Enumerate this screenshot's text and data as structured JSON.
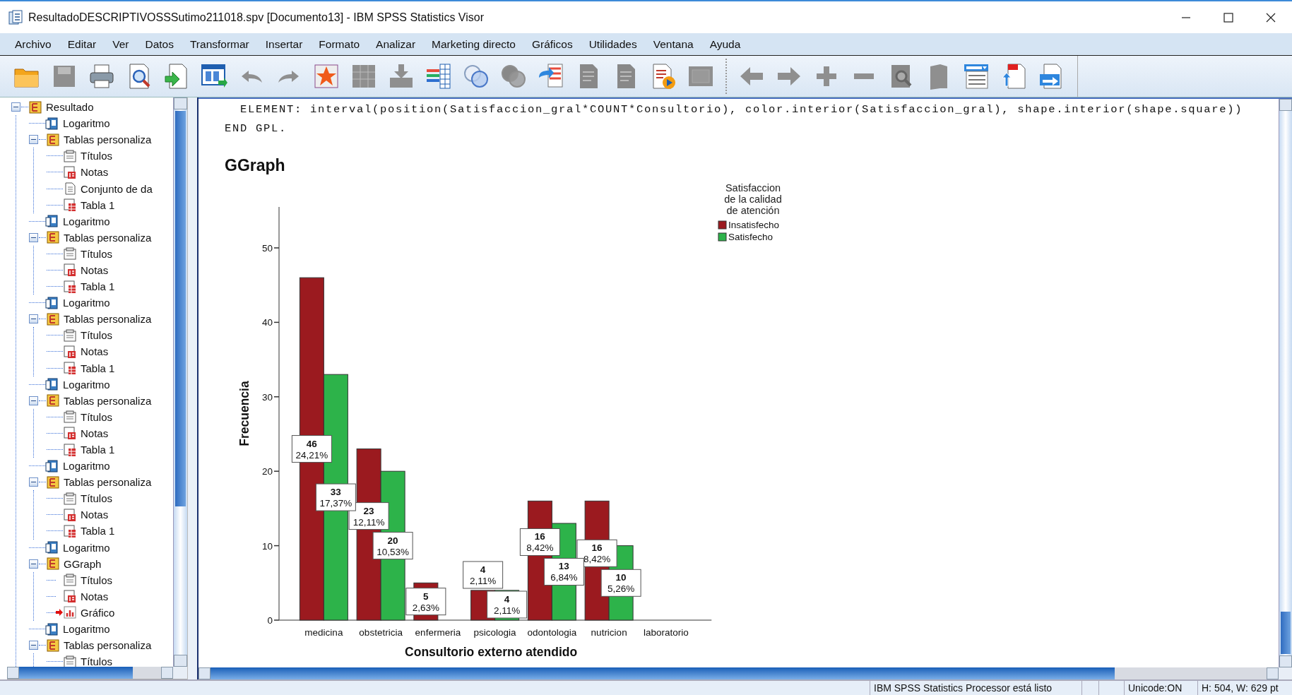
{
  "window": {
    "title": "ResultadoDESCRIPTIVOSSSutimo211018.spv [Documento13] - IBM SPSS Statistics Visor"
  },
  "menu": [
    "Archivo",
    "Editar",
    "Ver",
    "Datos",
    "Transformar",
    "Insertar",
    "Formato",
    "Analizar",
    "Marketing directo",
    "Gráficos",
    "Utilidades",
    "Ventana",
    "Ayuda"
  ],
  "toolbar": [
    {
      "kind": "folder",
      "disabled": false
    },
    {
      "kind": "save",
      "disabled": true
    },
    {
      "kind": "printer",
      "disabled": false
    },
    {
      "kind": "preview",
      "disabled": false
    },
    {
      "kind": "export",
      "disabled": false
    },
    {
      "kind": "datawindow",
      "disabled": false
    },
    {
      "kind": "undo",
      "disabled": true
    },
    {
      "kind": "redo",
      "disabled": true
    },
    {
      "kind": "startable",
      "disabled": false
    },
    {
      "kind": "grid",
      "disabled": true
    },
    {
      "kind": "download",
      "disabled": true
    },
    {
      "kind": "varlist",
      "disabled": false
    },
    {
      "kind": "circles",
      "disabled": false
    },
    {
      "kind": "circles",
      "disabled": true
    },
    {
      "kind": "arrowlist",
      "disabled": false
    },
    {
      "kind": "document",
      "disabled": true
    },
    {
      "kind": "document",
      "disabled": true
    },
    {
      "kind": "docplay",
      "disabled": false
    },
    {
      "kind": "frame",
      "disabled": true
    },
    {
      "kind": "separator"
    },
    {
      "kind": "left",
      "disabled": true
    },
    {
      "kind": "right",
      "disabled": true
    },
    {
      "kind": "plus",
      "disabled": true
    },
    {
      "kind": "minus",
      "disabled": true
    },
    {
      "kind": "docsearch",
      "disabled": true
    },
    {
      "kind": "book",
      "disabled": true
    },
    {
      "kind": "dropdown",
      "disabled": false
    },
    {
      "kind": "docup",
      "disabled": false
    },
    {
      "kind": "docarrow",
      "disabled": false
    }
  ],
  "tree": {
    "label": "Resultado",
    "kind": "root",
    "expanded": true,
    "children": [
      {
        "label": "Logaritmo",
        "kind": "log"
      },
      {
        "label": "Tablas personaliza",
        "kind": "group",
        "expanded": true,
        "children": [
          {
            "label": "Títulos",
            "kind": "titles"
          },
          {
            "label": "Notas",
            "kind": "notes"
          },
          {
            "label": "Conjunto de da",
            "kind": "dataset"
          },
          {
            "label": "Tabla 1",
            "kind": "table"
          }
        ]
      },
      {
        "label": "Logaritmo",
        "kind": "log"
      },
      {
        "label": "Tablas personaliza",
        "kind": "group",
        "expanded": true,
        "children": [
          {
            "label": "Títulos",
            "kind": "titles"
          },
          {
            "label": "Notas",
            "kind": "notes"
          },
          {
            "label": "Tabla 1",
            "kind": "table"
          }
        ]
      },
      {
        "label": "Logaritmo",
        "kind": "log"
      },
      {
        "label": "Tablas personaliza",
        "kind": "group",
        "expanded": true,
        "children": [
          {
            "label": "Títulos",
            "kind": "titles"
          },
          {
            "label": "Notas",
            "kind": "notes"
          },
          {
            "label": "Tabla 1",
            "kind": "table"
          }
        ]
      },
      {
        "label": "Logaritmo",
        "kind": "log"
      },
      {
        "label": "Tablas personaliza",
        "kind": "group",
        "expanded": true,
        "children": [
          {
            "label": "Títulos",
            "kind": "titles"
          },
          {
            "label": "Notas",
            "kind": "notes"
          },
          {
            "label": "Tabla 1",
            "kind": "table"
          }
        ]
      },
      {
        "label": "Logaritmo",
        "kind": "log"
      },
      {
        "label": "Tablas personaliza",
        "kind": "group",
        "expanded": true,
        "children": [
          {
            "label": "Títulos",
            "kind": "titles"
          },
          {
            "label": "Notas",
            "kind": "notes"
          },
          {
            "label": "Tabla 1",
            "kind": "table"
          }
        ]
      },
      {
        "label": "Logaritmo",
        "kind": "log"
      },
      {
        "label": "GGraph",
        "kind": "group",
        "expanded": true,
        "children": [
          {
            "label": "Títulos",
            "kind": "titles",
            "current": false
          },
          {
            "label": "Notas",
            "kind": "notes",
            "current": false
          },
          {
            "label": "Gráfico",
            "kind": "chart",
            "current": true
          }
        ]
      },
      {
        "label": "Logaritmo",
        "kind": "log"
      },
      {
        "label": "Tablas personaliza",
        "kind": "group",
        "expanded": true,
        "children": [
          {
            "label": "Títulos",
            "kind": "titles"
          }
        ]
      }
    ]
  },
  "output": {
    "syntax": [
      "  ELEMENT: interval(position(Satisfaccion_gral*COUNT*Consultorio), color.interior(Satisfaccion_gral), shape.interior(shape.square))",
      "END GPL."
    ],
    "heading": "GGraph",
    "chart_data": {
      "type": "bar",
      "xlabel": "Consultorio externo atendido",
      "ylabel": "Frecuencia",
      "categories": [
        "medicina",
        "obstetricia",
        "enfermeria",
        "psicologia",
        "odontologia",
        "nutricion",
        "laboratorio"
      ],
      "series": [
        {
          "name": "Insatisfecho",
          "color": "#9b1a1f",
          "values": [
            46,
            23,
            5,
            4,
            16,
            16,
            null
          ]
        },
        {
          "name": "Satisfecho",
          "color": "#2db34a",
          "values": [
            33,
            20,
            null,
            4,
            13,
            10,
            null
          ]
        }
      ],
      "ylim": [
        0,
        55.5
      ],
      "yticks": [
        0,
        10,
        20,
        30,
        40,
        50
      ],
      "data_labels": true,
      "value_labels": [
        [
          "24,21%",
          "12,11%",
          "2,63%",
          "2,11%",
          "8,42%",
          "8,42%",
          null
        ],
        [
          "17,37%",
          "10,53%",
          null,
          "2,11%",
          "6,84%",
          "5,26%",
          null
        ]
      ],
      "legend": {
        "title": [
          "Satisfaccion",
          "de la calidad",
          "de atención"
        ]
      }
    }
  },
  "status_bar": {
    "message": "IBM SPSS Statistics Processor está listo",
    "encoding": "Unicode:ON",
    "size": "H: 504, W: 629 pt"
  }
}
